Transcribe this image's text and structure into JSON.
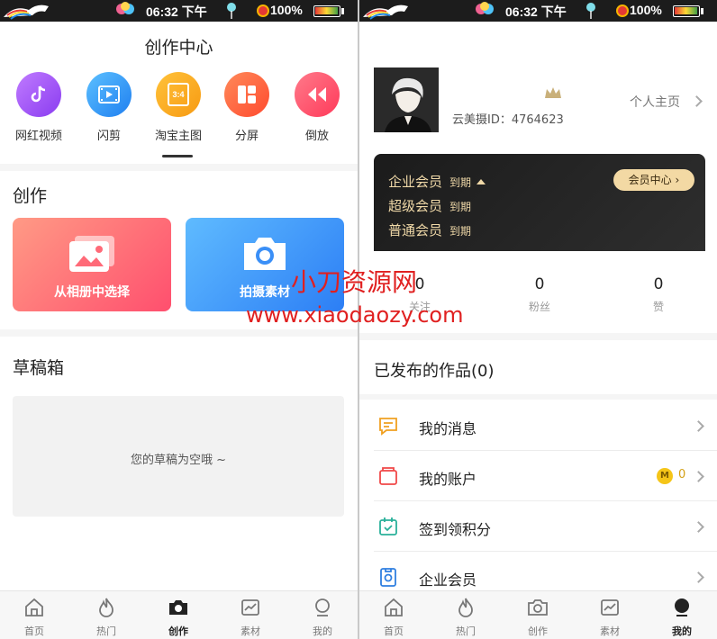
{
  "status_bar": {
    "time": "06:32 下午",
    "battery": "100%"
  },
  "left": {
    "title": "创作中心",
    "tools": [
      {
        "label": "网红视频",
        "icon": "tiktok-note-icon",
        "color": "#a15cf0"
      },
      {
        "label": "闪剪",
        "icon": "film-strip-icon",
        "color": "#2f8ef7"
      },
      {
        "label": "淘宝主图",
        "icon": "aspect-ratio-3-4-icon",
        "color": "#f7a21b",
        "icon_text": "3:4"
      },
      {
        "label": "分屏",
        "icon": "split-screen-icon",
        "color": "#ff5d3a"
      },
      {
        "label": "倒放",
        "icon": "rewind-icon",
        "color": "#ff4a6b"
      }
    ],
    "create_section_title": "创作",
    "create_cards": [
      {
        "label": "从相册中选择",
        "icon": "photo-album-icon",
        "color_from": "#ff8a7a",
        "color_to": "#ff4d6d"
      },
      {
        "label": "拍摄素材",
        "icon": "camera-icon",
        "color_from": "#5ab6ff",
        "color_to": "#2f80f6"
      }
    ],
    "drafts_title": "草稿箱",
    "drafts_empty": "您的草稿为空哦 ~"
  },
  "tabbar": {
    "tabs": [
      {
        "label": "首页",
        "icon": "home-icon"
      },
      {
        "label": "热门",
        "icon": "flame-icon"
      },
      {
        "label": "创作",
        "icon": "camera-icon"
      },
      {
        "label": "素材",
        "icon": "chart-icon"
      },
      {
        "label": "我的",
        "icon": "profile-icon"
      }
    ],
    "active_left": "创作",
    "active_right": "我的"
  },
  "right": {
    "user_id": "云美摄ID：4764623",
    "homepage_link": "个人主页",
    "membership": {
      "rows": [
        {
          "name": "企业会员",
          "expiry": "到期"
        },
        {
          "name": "超级会员",
          "expiry": "到期"
        },
        {
          "name": "普通会员",
          "expiry": "到期"
        }
      ],
      "center_button": "会员中心"
    },
    "stats": [
      {
        "value": "0",
        "label": "关注"
      },
      {
        "value": "0",
        "label": "粉丝"
      },
      {
        "value": "0",
        "label": "赞"
      }
    ],
    "published_title": "已发布的作品(0)",
    "menu": [
      {
        "label": "我的消息",
        "icon": "message-icon"
      },
      {
        "label": "我的账户",
        "icon": "wallet-icon",
        "coin_count": "0"
      },
      {
        "label": "签到领积分",
        "icon": "checkin-calendar-icon"
      },
      {
        "label": "企业会员",
        "icon": "enterprise-member-icon"
      }
    ]
  },
  "watermark": {
    "title": "小刀资源网",
    "url": "www.xiaodaozy.com"
  }
}
